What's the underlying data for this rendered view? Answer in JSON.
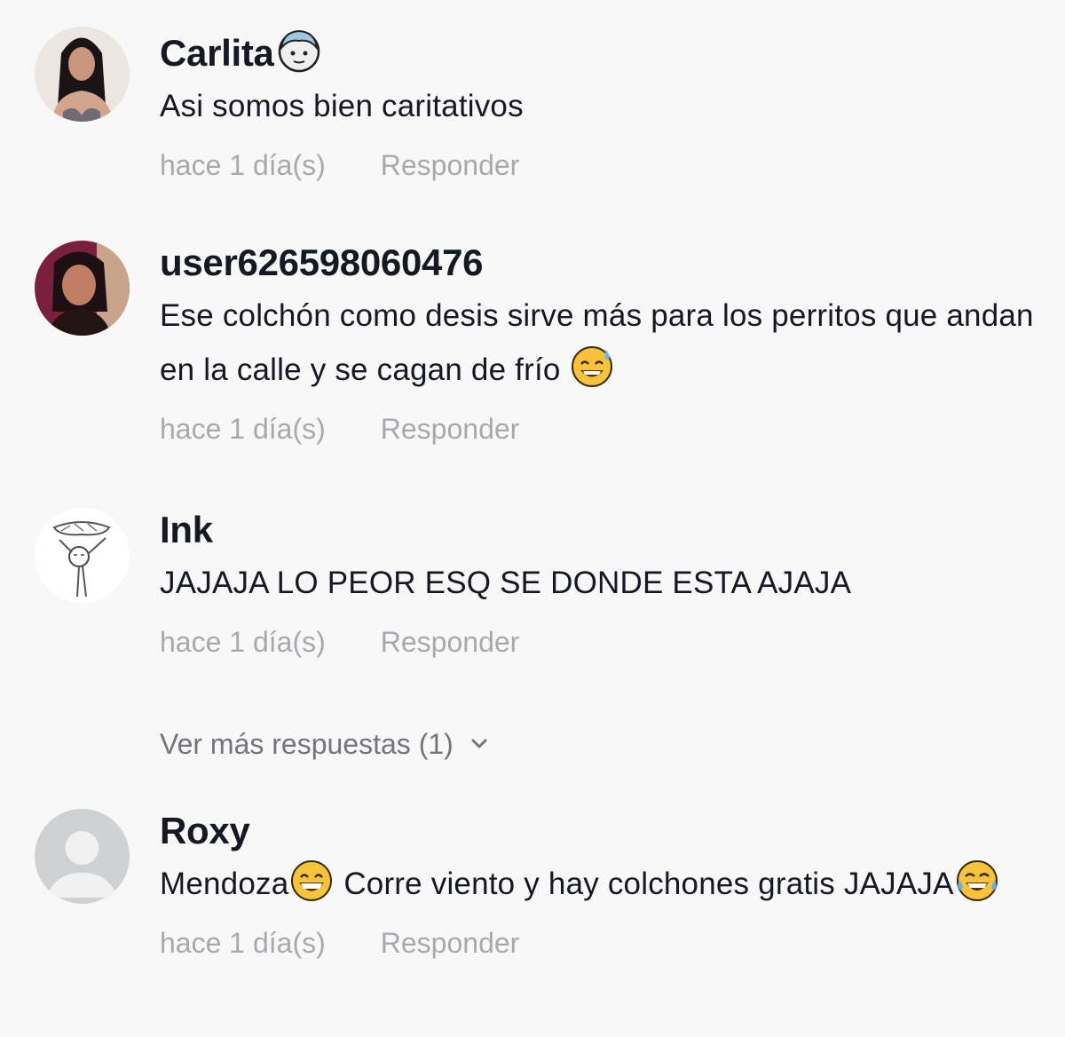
{
  "comments": [
    {
      "username": "Carlita",
      "username_emoji": "woman-face-emoji",
      "text_parts": [
        "Asi somos bien caritativos"
      ],
      "time": "hace 1 día(s)",
      "reply": "Responder"
    },
    {
      "username": "user626598060476",
      "text_parts": [
        "Ese colchón como desis sirve más para los perritos que andan en la calle y se cagan de frío "
      ],
      "text_emoji": "grinning-sweat-emoji",
      "time": "hace 1 día(s)",
      "reply": "Responder"
    },
    {
      "username": "Ink",
      "text_parts": [
        "JAJAJA LO PEOR ESQ SE DONDE ESTA AJAJA"
      ],
      "time": "hace 1 día(s)",
      "reply": "Responder",
      "more_replies": "Ver más respuestas (1)"
    },
    {
      "username": "Roxy",
      "text_parts": [
        "Mendoza",
        " Corre viento y hay colchones gratis JAJAJA"
      ],
      "text_emojis": [
        "beaming-face-emoji",
        "tears-of-joy-emoji"
      ],
      "time": "hace 1 día(s)",
      "reply": "Responder"
    }
  ],
  "colors": {
    "background": "#f8f8f8",
    "primary_text": "#161823",
    "meta_text": "#a8a9ad",
    "more_replies_text": "#73757b"
  }
}
